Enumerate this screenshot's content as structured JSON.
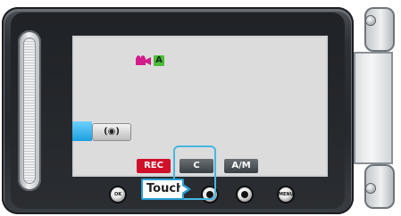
{
  "screen": {
    "mode_badge": "A",
    "stabilizer_label": "(◉)",
    "tabs": [
      "REC",
      "C",
      "A/M"
    ]
  },
  "controls": {
    "ok_label": "OK",
    "menu_label": "MENU"
  },
  "callout": {
    "touch_label": "Touch"
  },
  "icons": {
    "video_camera": "video-camera-icon",
    "stabilizer": "image-stabilizer-icon"
  },
  "colors": {
    "rec_red": "#d0102a",
    "auto_green": "#4cba3b",
    "highlight_blue": "#45b7e2"
  }
}
